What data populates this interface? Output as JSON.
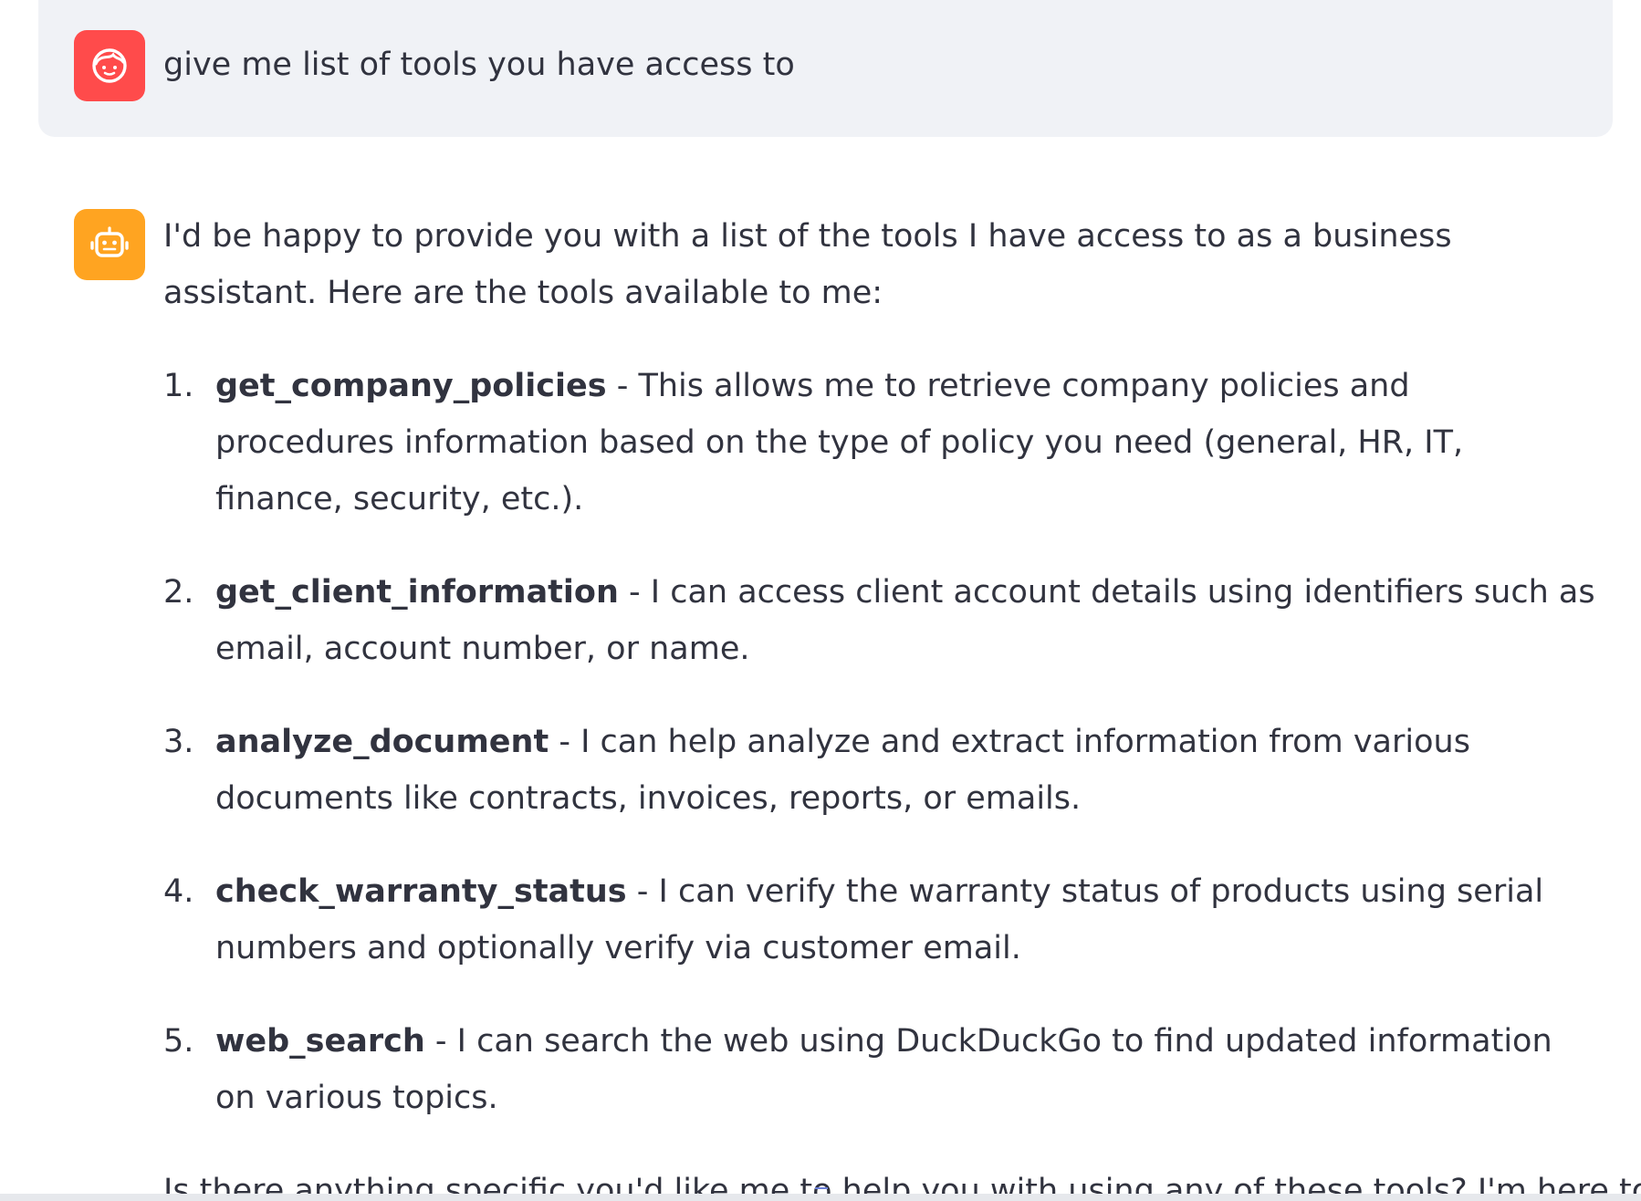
{
  "colors": {
    "user_avatar_bg": "#ff4b4b",
    "bot_avatar_bg": "#ffa421",
    "user_bubble_bg": "#f0f2f6",
    "text": "#31333f"
  },
  "user_message": {
    "avatar_icon": "user-face-icon",
    "text": "give me list of tools you have access to"
  },
  "assistant_message": {
    "avatar_icon": "robot-icon",
    "intro": "I'd be happy to provide you with a list of the tools I have access to as a business assistant. Here are the tools available to me:",
    "tools": [
      {
        "number": "1.",
        "name": "get_company_policies",
        "description": " - This allows me to retrieve company policies and procedures information based on the type of policy you need (general, HR, IT, finance, security, etc.)."
      },
      {
        "number": "2.",
        "name": "get_client_information",
        "description": " - I can access client account details using identifiers such as email, account number, or name."
      },
      {
        "number": "3.",
        "name": "analyze_document",
        "description": " - I can help analyze and extract information from various documents like contracts, invoices, reports, or emails."
      },
      {
        "number": "4.",
        "name": "check_warranty_status",
        "description": " - I can verify the warranty status of products using serial numbers and optionally verify via customer email."
      },
      {
        "number": "5.",
        "name": "web_search",
        "description": " - I can search the web using DuckDuckGo to find updated information on various topics."
      }
    ],
    "closing": "Is there anything specific you'd like me to help you with using any of these tools? I'm here to"
  }
}
